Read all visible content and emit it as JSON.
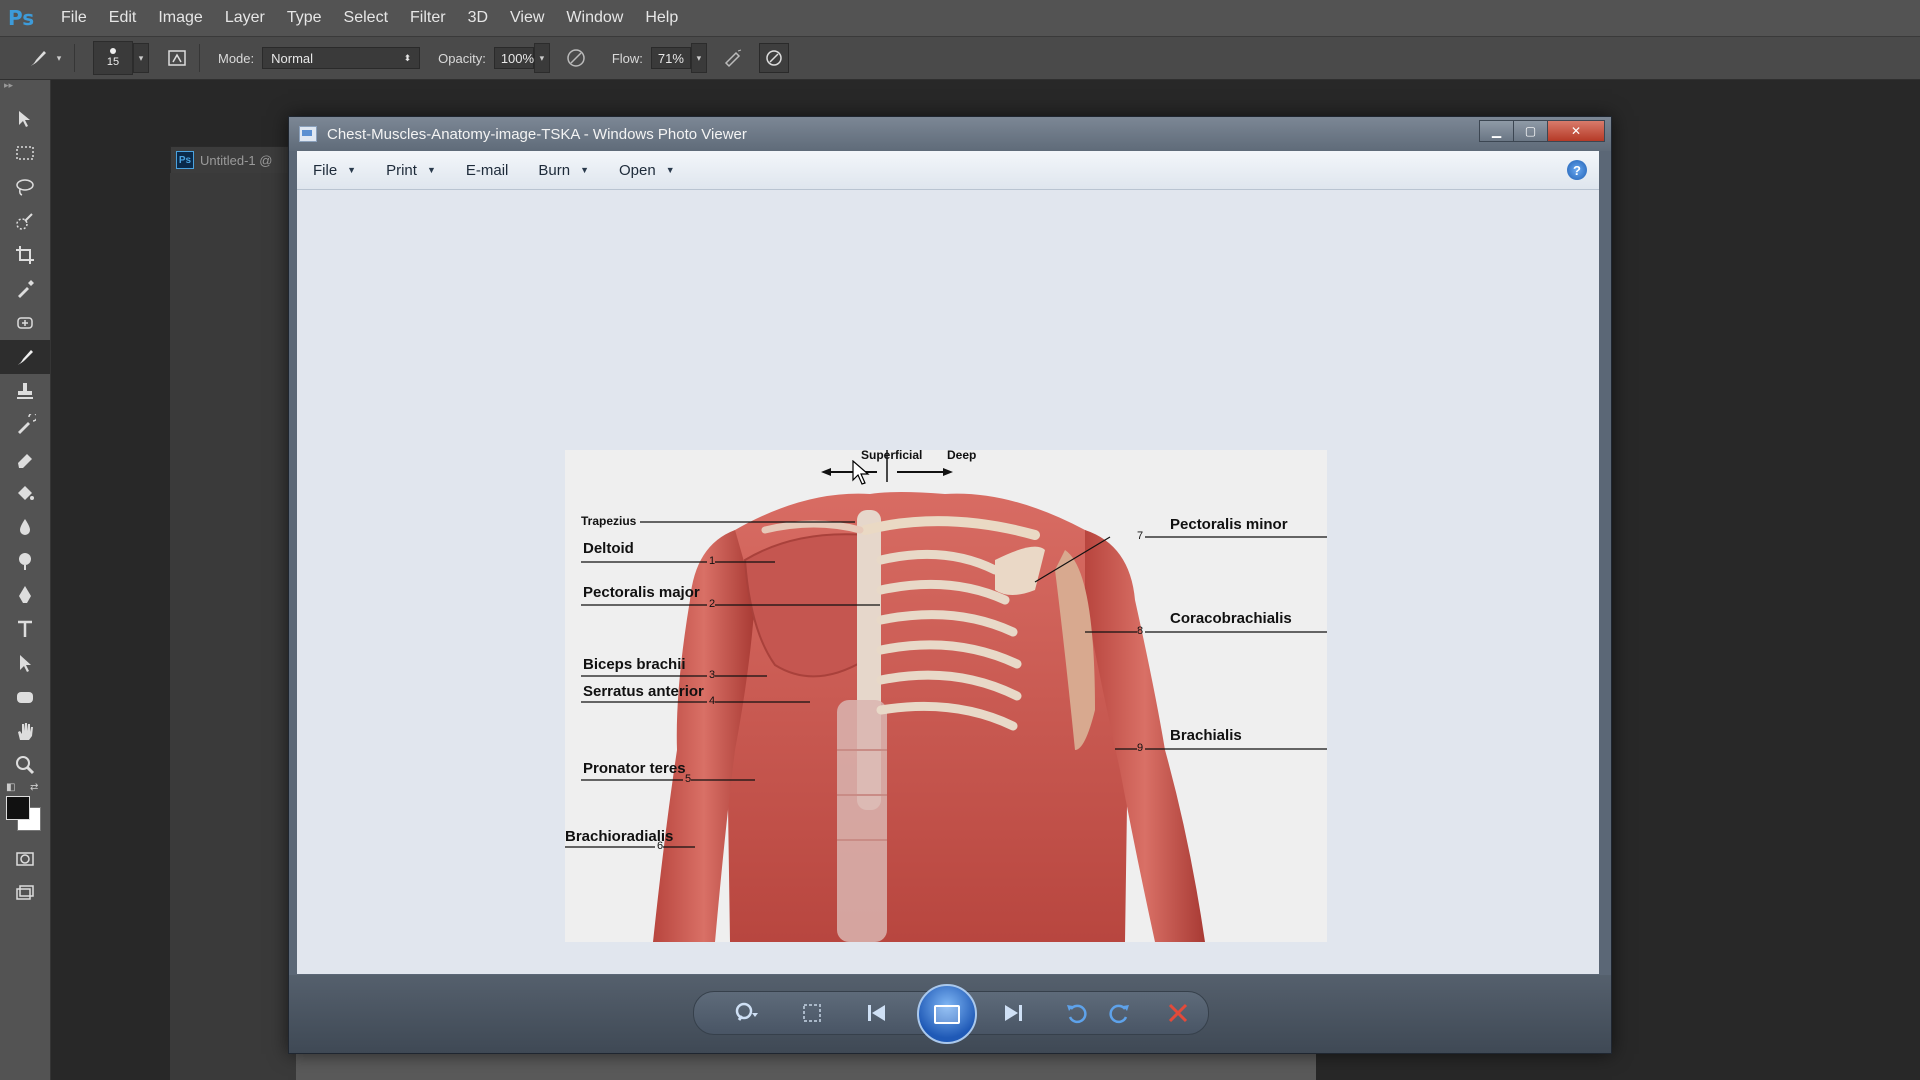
{
  "photoshop": {
    "logo": "Ps",
    "menu": [
      "File",
      "Edit",
      "Image",
      "Layer",
      "Type",
      "Select",
      "Filter",
      "3D",
      "View",
      "Window",
      "Help"
    ],
    "options": {
      "brush_size": "15",
      "mode_label": "Mode:",
      "mode_value": "Normal",
      "opacity_label": "Opacity:",
      "opacity_value": "100%",
      "flow_label": "Flow:",
      "flow_value": "71%"
    },
    "document_tab": "Untitled-1 @",
    "document_badge": "Ps"
  },
  "photo_viewer": {
    "title": "Chest-Muscles-Anatomy-image-TSKA - Windows Photo Viewer",
    "menu": {
      "file": "File",
      "print": "Print",
      "email": "E-mail",
      "burn": "Burn",
      "open": "Open"
    },
    "help": "?"
  },
  "image": {
    "header_left": "Superficial",
    "header_right": "Deep",
    "labels_left": [
      {
        "text": "Trapezius",
        "num": ""
      },
      {
        "text": "Deltoid",
        "num": "1"
      },
      {
        "text": "Pectoralis major",
        "num": "2"
      },
      {
        "text": "Biceps brachii",
        "num": "3"
      },
      {
        "text": "Serratus anterior",
        "num": "4"
      },
      {
        "text": "Pronator teres",
        "num": "5"
      },
      {
        "text": "Brachioradialis",
        "num": "6"
      }
    ],
    "labels_right": [
      {
        "text": "Pectoralis minor",
        "num": "7"
      },
      {
        "text": "Coracobrachialis",
        "num": "8"
      },
      {
        "text": "Brachialis",
        "num": "9"
      }
    ]
  },
  "colors": {
    "ps_bg": "#282828",
    "muscle": "#c9544e",
    "bone": "#e8d9c8"
  }
}
